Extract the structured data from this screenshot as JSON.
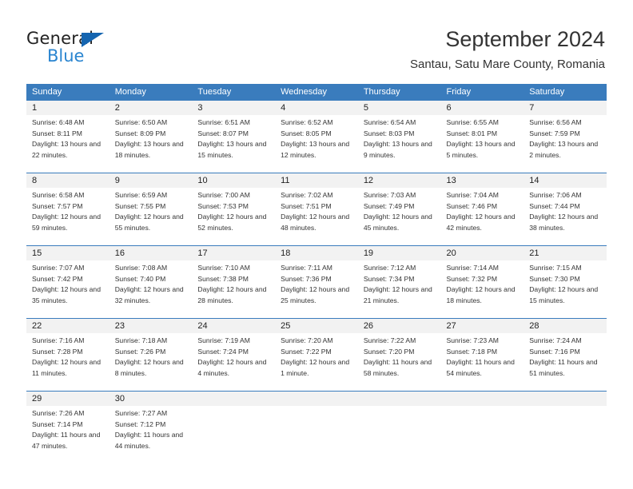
{
  "brand": {
    "name_part1": "General",
    "name_part2": "Blue",
    "accent_color": "#2a85d0",
    "triangle_color": "#1565b0"
  },
  "header": {
    "title": "September 2024",
    "subtitle": "Santau, Satu Mare County, Romania"
  },
  "theme": {
    "header_band": "#3a7cbd",
    "number_row_bg": "#f2f2f2",
    "text": "#333333"
  },
  "weekday_headers": [
    "Sunday",
    "Monday",
    "Tuesday",
    "Wednesday",
    "Thursday",
    "Friday",
    "Saturday"
  ],
  "weeks": [
    {
      "days": [
        {
          "num": "1",
          "sunrise": "Sunrise: 6:48 AM",
          "sunset": "Sunset: 8:11 PM",
          "daylight": "Daylight: 13 hours and 22 minutes."
        },
        {
          "num": "2",
          "sunrise": "Sunrise: 6:50 AM",
          "sunset": "Sunset: 8:09 PM",
          "daylight": "Daylight: 13 hours and 18 minutes."
        },
        {
          "num": "3",
          "sunrise": "Sunrise: 6:51 AM",
          "sunset": "Sunset: 8:07 PM",
          "daylight": "Daylight: 13 hours and 15 minutes."
        },
        {
          "num": "4",
          "sunrise": "Sunrise: 6:52 AM",
          "sunset": "Sunset: 8:05 PM",
          "daylight": "Daylight: 13 hours and 12 minutes."
        },
        {
          "num": "5",
          "sunrise": "Sunrise: 6:54 AM",
          "sunset": "Sunset: 8:03 PM",
          "daylight": "Daylight: 13 hours and 9 minutes."
        },
        {
          "num": "6",
          "sunrise": "Sunrise: 6:55 AM",
          "sunset": "Sunset: 8:01 PM",
          "daylight": "Daylight: 13 hours and 5 minutes."
        },
        {
          "num": "7",
          "sunrise": "Sunrise: 6:56 AM",
          "sunset": "Sunset: 7:59 PM",
          "daylight": "Daylight: 13 hours and 2 minutes."
        }
      ]
    },
    {
      "days": [
        {
          "num": "8",
          "sunrise": "Sunrise: 6:58 AM",
          "sunset": "Sunset: 7:57 PM",
          "daylight": "Daylight: 12 hours and 59 minutes."
        },
        {
          "num": "9",
          "sunrise": "Sunrise: 6:59 AM",
          "sunset": "Sunset: 7:55 PM",
          "daylight": "Daylight: 12 hours and 55 minutes."
        },
        {
          "num": "10",
          "sunrise": "Sunrise: 7:00 AM",
          "sunset": "Sunset: 7:53 PM",
          "daylight": "Daylight: 12 hours and 52 minutes."
        },
        {
          "num": "11",
          "sunrise": "Sunrise: 7:02 AM",
          "sunset": "Sunset: 7:51 PM",
          "daylight": "Daylight: 12 hours and 48 minutes."
        },
        {
          "num": "12",
          "sunrise": "Sunrise: 7:03 AM",
          "sunset": "Sunset: 7:49 PM",
          "daylight": "Daylight: 12 hours and 45 minutes."
        },
        {
          "num": "13",
          "sunrise": "Sunrise: 7:04 AM",
          "sunset": "Sunset: 7:46 PM",
          "daylight": "Daylight: 12 hours and 42 minutes."
        },
        {
          "num": "14",
          "sunrise": "Sunrise: 7:06 AM",
          "sunset": "Sunset: 7:44 PM",
          "daylight": "Daylight: 12 hours and 38 minutes."
        }
      ]
    },
    {
      "days": [
        {
          "num": "15",
          "sunrise": "Sunrise: 7:07 AM",
          "sunset": "Sunset: 7:42 PM",
          "daylight": "Daylight: 12 hours and 35 minutes."
        },
        {
          "num": "16",
          "sunrise": "Sunrise: 7:08 AM",
          "sunset": "Sunset: 7:40 PM",
          "daylight": "Daylight: 12 hours and 32 minutes."
        },
        {
          "num": "17",
          "sunrise": "Sunrise: 7:10 AM",
          "sunset": "Sunset: 7:38 PM",
          "daylight": "Daylight: 12 hours and 28 minutes."
        },
        {
          "num": "18",
          "sunrise": "Sunrise: 7:11 AM",
          "sunset": "Sunset: 7:36 PM",
          "daylight": "Daylight: 12 hours and 25 minutes."
        },
        {
          "num": "19",
          "sunrise": "Sunrise: 7:12 AM",
          "sunset": "Sunset: 7:34 PM",
          "daylight": "Daylight: 12 hours and 21 minutes."
        },
        {
          "num": "20",
          "sunrise": "Sunrise: 7:14 AM",
          "sunset": "Sunset: 7:32 PM",
          "daylight": "Daylight: 12 hours and 18 minutes."
        },
        {
          "num": "21",
          "sunrise": "Sunrise: 7:15 AM",
          "sunset": "Sunset: 7:30 PM",
          "daylight": "Daylight: 12 hours and 15 minutes."
        }
      ]
    },
    {
      "days": [
        {
          "num": "22",
          "sunrise": "Sunrise: 7:16 AM",
          "sunset": "Sunset: 7:28 PM",
          "daylight": "Daylight: 12 hours and 11 minutes."
        },
        {
          "num": "23",
          "sunrise": "Sunrise: 7:18 AM",
          "sunset": "Sunset: 7:26 PM",
          "daylight": "Daylight: 12 hours and 8 minutes."
        },
        {
          "num": "24",
          "sunrise": "Sunrise: 7:19 AM",
          "sunset": "Sunset: 7:24 PM",
          "daylight": "Daylight: 12 hours and 4 minutes."
        },
        {
          "num": "25",
          "sunrise": "Sunrise: 7:20 AM",
          "sunset": "Sunset: 7:22 PM",
          "daylight": "Daylight: 12 hours and 1 minute."
        },
        {
          "num": "26",
          "sunrise": "Sunrise: 7:22 AM",
          "sunset": "Sunset: 7:20 PM",
          "daylight": "Daylight: 11 hours and 58 minutes."
        },
        {
          "num": "27",
          "sunrise": "Sunrise: 7:23 AM",
          "sunset": "Sunset: 7:18 PM",
          "daylight": "Daylight: 11 hours and 54 minutes."
        },
        {
          "num": "28",
          "sunrise": "Sunrise: 7:24 AM",
          "sunset": "Sunset: 7:16 PM",
          "daylight": "Daylight: 11 hours and 51 minutes."
        }
      ]
    },
    {
      "days": [
        {
          "num": "29",
          "sunrise": "Sunrise: 7:26 AM",
          "sunset": "Sunset: 7:14 PM",
          "daylight": "Daylight: 11 hours and 47 minutes."
        },
        {
          "num": "30",
          "sunrise": "Sunrise: 7:27 AM",
          "sunset": "Sunset: 7:12 PM",
          "daylight": "Daylight: 11 hours and 44 minutes."
        },
        {
          "num": "",
          "sunrise": "",
          "sunset": "",
          "daylight": ""
        },
        {
          "num": "",
          "sunrise": "",
          "sunset": "",
          "daylight": ""
        },
        {
          "num": "",
          "sunrise": "",
          "sunset": "",
          "daylight": ""
        },
        {
          "num": "",
          "sunrise": "",
          "sunset": "",
          "daylight": ""
        },
        {
          "num": "",
          "sunrise": "",
          "sunset": "",
          "daylight": ""
        }
      ]
    }
  ]
}
